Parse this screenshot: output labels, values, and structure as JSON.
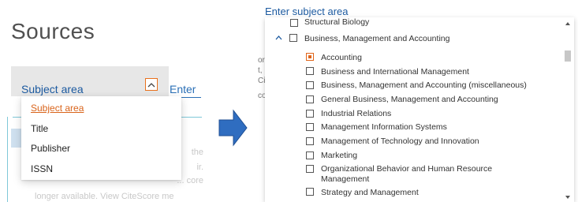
{
  "page": {
    "title": "Sources"
  },
  "left": {
    "subject_select_label": "Subject area",
    "enter_text": "Enter",
    "dropdown": {
      "options": [
        "Subject area",
        "Title",
        "Publisher",
        "ISSN"
      ],
      "selected": "Subject area"
    },
    "faded": {
      "line1": "the",
      "line2": "ir.",
      "line3": "... core",
      "line4": "longer available.   View CiteScore me"
    }
  },
  "right": {
    "enter_text": "Enter subject area",
    "peek": [
      "or",
      "t,",
      "Ci",
      "co"
    ],
    "top_item": "Structural Biology",
    "parent": {
      "label": "Business, Management and Accounting",
      "expanded": true
    },
    "items": [
      {
        "label": "Accounting",
        "checked": true
      },
      {
        "label": "Business and International Management",
        "checked": false
      },
      {
        "label": "Business, Management and Accounting (miscellaneous)",
        "checked": false
      },
      {
        "label": "General Business, Management and Accounting",
        "checked": false
      },
      {
        "label": "Industrial Relations",
        "checked": false
      },
      {
        "label": "Management Information Systems",
        "checked": false
      },
      {
        "label": "Management of Technology and Innovation",
        "checked": false
      },
      {
        "label": "Marketing",
        "checked": false
      },
      {
        "label": "Organizational Behavior and Human Resource Management",
        "checked": false
      },
      {
        "label": "Strategy and Management",
        "checked": false
      }
    ]
  },
  "colors": {
    "accent_orange": "#e9711c",
    "link_blue": "#1c5aa0",
    "arrow_blue": "#2f6dc0"
  },
  "icons": {
    "caret": "chevron-up-icon",
    "arrow": "arrow-right-icon"
  }
}
